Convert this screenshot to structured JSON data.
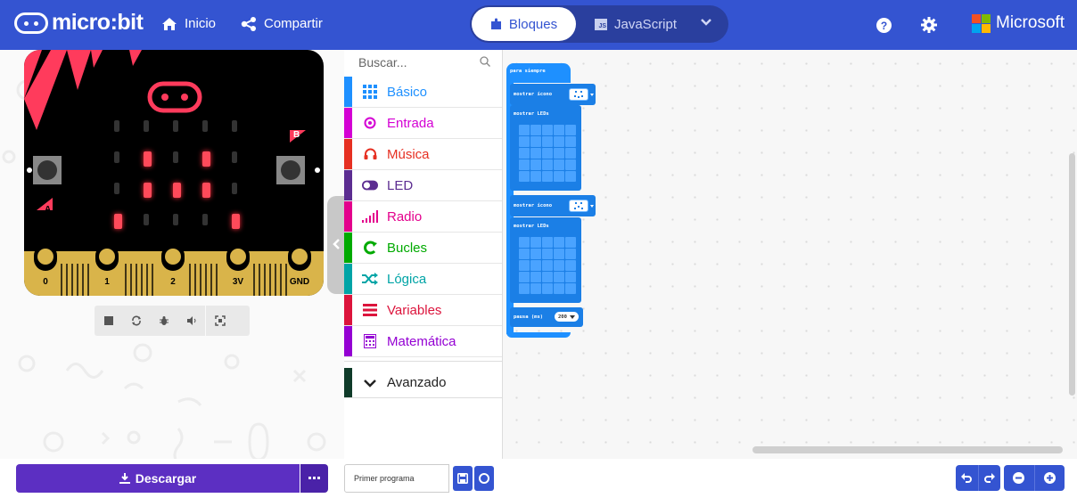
{
  "header": {
    "logo_text": "micro:bit",
    "home_label": "Inicio",
    "share_label": "Compartir",
    "blocks_label": "Bloques",
    "js_label": "JavaScript",
    "js_badge": "JS",
    "microsoft_label": "Microsoft",
    "accent_color": "#3454d1"
  },
  "simulator": {
    "pins": [
      "0",
      "1",
      "2",
      "3V",
      "GND"
    ],
    "button_a": "A",
    "button_b": "B",
    "lit_leds": [
      [
        1,
        1
      ],
      [
        1,
        3
      ],
      [
        2,
        1
      ],
      [
        2,
        2
      ],
      [
        2,
        3
      ],
      [
        3,
        0
      ],
      [
        3,
        4
      ]
    ],
    "toolbar_icons": [
      "stop-icon",
      "restart-icon",
      "debug-icon",
      "mute-icon",
      "fullscreen-icon"
    ]
  },
  "toolbox": {
    "search_placeholder": "Buscar...",
    "categories": [
      {
        "label": "Básico",
        "color": "#1e90ff",
        "icon": "grid-icon"
      },
      {
        "label": "Entrada",
        "color": "#d400d4",
        "icon": "target-icon"
      },
      {
        "label": "Música",
        "color": "#e63022",
        "icon": "headphones-icon"
      },
      {
        "label": "LED",
        "color": "#5c2d91",
        "icon": "toggle-icon"
      },
      {
        "label": "Radio",
        "color": "#e3008c",
        "icon": "signal-icon"
      },
      {
        "label": "Bucles",
        "color": "#00aa00",
        "icon": "loop-icon"
      },
      {
        "label": "Lógica",
        "color": "#00a4a6",
        "icon": "shuffle-icon"
      },
      {
        "label": "Variables",
        "color": "#dc143c",
        "icon": "lines-icon"
      },
      {
        "label": "Matemática",
        "color": "#9400d3",
        "icon": "calculator-icon"
      }
    ],
    "advanced_label": "Avanzado"
  },
  "workspace": {
    "forever_label": "para siempre",
    "show_icon_label": "mostrar ícono",
    "show_leds_label": "mostrar LEDs",
    "pause_label": "pausa (ms)",
    "pause_value": "200"
  },
  "footer": {
    "download_label": "Descargar",
    "project_name": "Primer programa",
    "download_color": "#5c2fc2"
  }
}
